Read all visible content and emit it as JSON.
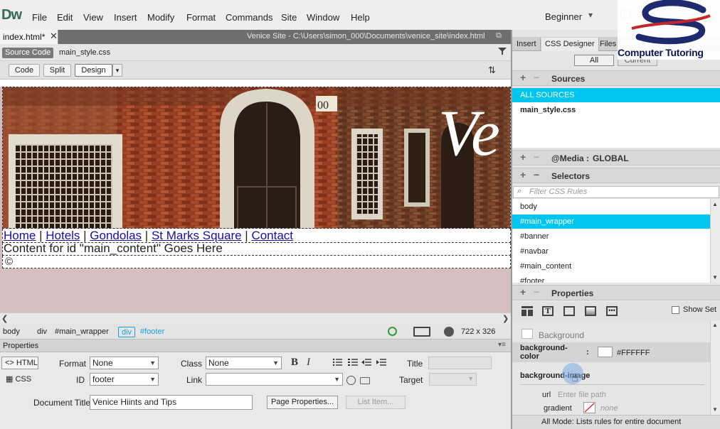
{
  "app": {
    "logo": "Dw",
    "workspace": "Beginner"
  },
  "menu": [
    "File",
    "Edit",
    "View",
    "Insert",
    "Modify",
    "Format",
    "Commands",
    "Site",
    "Window",
    "Help"
  ],
  "document": {
    "tab_label": "index.html*",
    "path": "Venice Site - C:\\Users\\simon_000\\Documents\\venice_site\\index.html",
    "source_code": "Source Code",
    "related_file": "main_style.css"
  },
  "views": {
    "code": "Code",
    "split": "Split",
    "design": "Design"
  },
  "page": {
    "banner_text": "Ve",
    "nav_links": [
      "Home",
      "Hotels",
      "Gondolas",
      "St Marks Square",
      "Contact"
    ],
    "nav_separator": " | ",
    "main_content_text": "Content for id \"main_content\" Goes Here",
    "footer_text": "©"
  },
  "tag_selector": {
    "items": [
      {
        "label": "body",
        "active": false
      },
      {
        "label": "div",
        "active": false
      },
      {
        "label": "#main_wrapper",
        "active": false
      },
      {
        "label": "div",
        "active": true
      },
      {
        "label": "#footer",
        "active": true
      }
    ],
    "window_size": "722 x 326"
  },
  "properties": {
    "title": "Properties",
    "html_btn": "HTML",
    "css_btn": "CSS",
    "format_label": "Format",
    "format_value": "None",
    "id_label": "ID",
    "id_value": "footer",
    "class_label": "Class",
    "class_value": "None",
    "link_label": "Link",
    "link_value": "",
    "bold": "B",
    "italic": "I",
    "title_label": "Title",
    "target_label": "Target",
    "doc_title_label": "Document Title",
    "doc_title_value": "Venice Hiints and Tips",
    "page_props_btn": "Page Properties...",
    "list_item_btn": "List Item..."
  },
  "right_panel": {
    "tabs": [
      "Insert",
      "CSS Designer",
      "Files"
    ],
    "active_tab": "CSS Designer",
    "mode_all": "All",
    "mode_current": "Current",
    "sources_title": "Sources",
    "all_sources": "ALL SOURCES",
    "source_file": "main_style.css",
    "media_title": "@Media :",
    "media_value": "GLOBAL",
    "selectors_title": "Selectors",
    "filter_placeholder": "Filter CSS Rules",
    "selectors": [
      "body",
      "#main_wrapper",
      "#banner",
      "#navbar",
      "#main_content",
      "#footer"
    ],
    "selected_selector": "#main_wrapper",
    "properties_title": "Properties",
    "show_set": "Show Set",
    "background_heading": "Background",
    "bg_color_label": "background-color",
    "bg_color_value": "#FFFFFF",
    "bg_image_label": "background-image",
    "url_label": "url",
    "url_placeholder": "Enter file path",
    "gradient_label": "gradient",
    "gradient_value": "none",
    "status": "All Mode: Lists rules for entire document"
  },
  "watermark": {
    "text": "Computer Tutoring"
  },
  "colors": {
    "selection": "#00c6ef",
    "tag_active": "#1b9fd8",
    "link": "#1a0dab"
  }
}
